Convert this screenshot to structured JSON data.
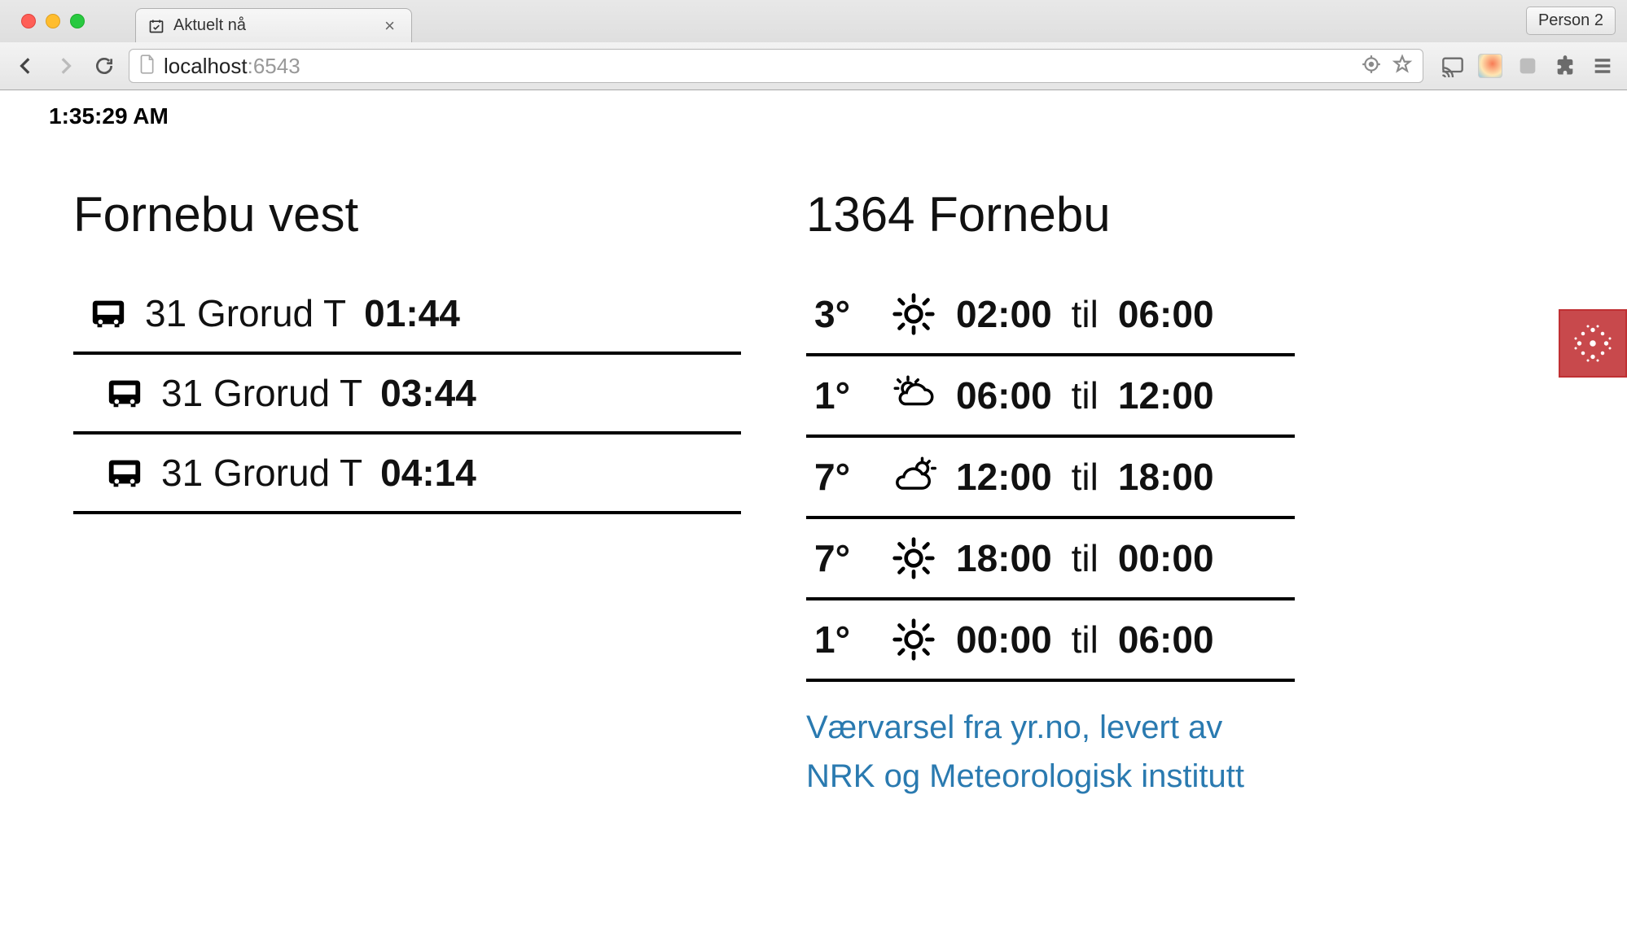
{
  "browser": {
    "tab_title": "Aktuelt nå",
    "url_host": "localhost",
    "url_port": ":6543",
    "person_label": "Person 2"
  },
  "clock": "1:35:29 AM",
  "transport": {
    "title": "Fornebu vest",
    "departures": [
      {
        "route": "31 Grorud T",
        "time": "01:44"
      },
      {
        "route": "31 Grorud T",
        "time": "03:44"
      },
      {
        "route": "31 Grorud T",
        "time": "04:14"
      }
    ]
  },
  "weather": {
    "title": "1364 Fornebu",
    "til_word": "til",
    "forecasts": [
      {
        "temp": "3°",
        "icon": "sun",
        "from": "02:00",
        "to": "06:00"
      },
      {
        "temp": "1°",
        "icon": "sun-cloud-a",
        "from": "06:00",
        "to": "12:00"
      },
      {
        "temp": "7°",
        "icon": "sun-cloud-b",
        "from": "12:00",
        "to": "18:00"
      },
      {
        "temp": "7°",
        "icon": "sun",
        "from": "18:00",
        "to": "00:00"
      },
      {
        "temp": "1°",
        "icon": "sun",
        "from": "00:00",
        "to": "06:00"
      }
    ],
    "credit": "Værvarsel fra yr.no, levert av NRK og Meteorologisk institutt"
  }
}
